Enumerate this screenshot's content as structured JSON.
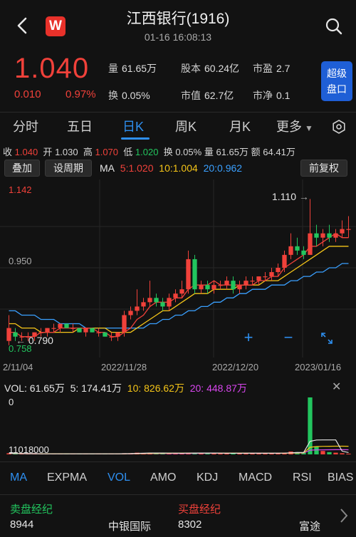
{
  "header": {
    "title": "江西银行(1916)",
    "subtitle": "01-16 16:08:13",
    "logo_letter": "W"
  },
  "quote": {
    "price": "1.040",
    "change": "0.010",
    "change_pct": "0.97%",
    "stats": [
      {
        "k": "量",
        "v": "61.65万"
      },
      {
        "k": "股本",
        "v": "60.24亿"
      },
      {
        "k": "市盈",
        "v": "2.7"
      },
      {
        "k": "换",
        "v": "0.05%"
      },
      {
        "k": "市值",
        "v": "62.7亿"
      },
      {
        "k": "市净",
        "v": "0.1"
      }
    ],
    "super_btn_l1": "超级",
    "super_btn_l2": "盘口"
  },
  "tabs": [
    "分时",
    "五日",
    "日K",
    "周K",
    "月K",
    "更多"
  ],
  "active_tab": "日K",
  "infobar": {
    "close_k": "收",
    "close_v": "1.040",
    "open_k": "开",
    "open_v": "1.030",
    "high_k": "高",
    "high_v": "1.070",
    "low_k": "低",
    "low_v": "1.020",
    "turn_k": "换",
    "turn_v": "0.05%",
    "vol_k": "量",
    "vol_v": "61.65万",
    "amt_k": "额",
    "amt_v": "64.41万"
  },
  "toolbar": {
    "overlay": "叠加",
    "period": "设周期",
    "ma_label": "MA",
    "ma5": "5:1.020",
    "ma10": "10:1.004",
    "ma20": "20:0.962",
    "adjust": "前复权"
  },
  "chart_labels": {
    "top": "1.142",
    "mid": "0.950",
    "bottom": "0.758",
    "max_mark": "1.110",
    "min_mark": "0.790",
    "dates": [
      "2/11/04",
      "2022/11/28",
      "2022/12/20",
      "2023/01/16"
    ]
  },
  "volume": {
    "label": "VOL: 61.65万",
    "v5": "5: 174.41万",
    "v10": "10: 826.62万",
    "v20": "20: 448.87万",
    "top": "0",
    "bottom": "11018000"
  },
  "indicators": [
    "MA",
    "EXPMA",
    "VOL",
    "AMO",
    "KDJ",
    "MACD",
    "RSI",
    "BIAS"
  ],
  "active_indicators": [
    "MA",
    "VOL"
  ],
  "brokers": {
    "sell_title": "卖盘经纪",
    "buy_title": "买盘经纪",
    "sell_code": "8944",
    "sell_name": "中银国际",
    "buy_code": "8302",
    "buy_name": "富途"
  },
  "colors": {
    "up": "#f0413a",
    "down": "#22c55e",
    "accent": "#2e8ff0",
    "ma5": "#f0413a",
    "ma10": "#f5c518",
    "ma20": "#3aa0ff"
  },
  "chart_data": {
    "type": "candlestick",
    "ylim": [
      0.758,
      1.142
    ],
    "max": 1.11,
    "min": 0.79,
    "ohlc": [
      [
        0.78,
        0.84,
        0.77,
        0.81
      ],
      [
        0.8,
        0.81,
        0.78,
        0.79
      ],
      [
        0.79,
        0.8,
        0.78,
        0.79
      ],
      [
        0.79,
        0.8,
        0.78,
        0.79
      ],
      [
        0.79,
        0.8,
        0.78,
        0.8
      ],
      [
        0.8,
        0.81,
        0.79,
        0.8
      ],
      [
        0.8,
        0.81,
        0.79,
        0.81
      ],
      [
        0.81,
        0.82,
        0.8,
        0.81
      ],
      [
        0.81,
        0.82,
        0.8,
        0.82
      ],
      [
        0.82,
        0.82,
        0.81,
        0.81
      ],
      [
        0.81,
        0.82,
        0.8,
        0.81
      ],
      [
        0.81,
        0.81,
        0.8,
        0.8
      ],
      [
        0.8,
        0.81,
        0.79,
        0.81
      ],
      [
        0.81,
        0.81,
        0.8,
        0.8
      ],
      [
        0.8,
        0.81,
        0.79,
        0.8
      ],
      [
        0.8,
        0.8,
        0.79,
        0.79
      ],
      [
        0.79,
        0.8,
        0.78,
        0.79
      ],
      [
        0.79,
        0.8,
        0.78,
        0.8
      ],
      [
        0.8,
        0.85,
        0.79,
        0.84
      ],
      [
        0.84,
        0.86,
        0.83,
        0.85
      ],
      [
        0.85,
        0.9,
        0.84,
        0.86
      ],
      [
        0.86,
        0.88,
        0.85,
        0.87
      ],
      [
        0.87,
        0.92,
        0.86,
        0.88
      ],
      [
        0.88,
        0.89,
        0.86,
        0.87
      ],
      [
        0.87,
        0.88,
        0.85,
        0.86
      ],
      [
        0.86,
        0.89,
        0.85,
        0.88
      ],
      [
        0.88,
        0.9,
        0.87,
        0.89
      ],
      [
        0.89,
        0.92,
        0.88,
        0.9
      ],
      [
        0.9,
        0.99,
        0.89,
        0.97
      ],
      [
        0.97,
        0.98,
        0.89,
        0.9
      ],
      [
        0.9,
        0.92,
        0.89,
        0.91
      ],
      [
        0.91,
        0.92,
        0.89,
        0.9
      ],
      [
        0.9,
        0.92,
        0.89,
        0.91
      ],
      [
        0.91,
        0.92,
        0.9,
        0.91
      ],
      [
        0.91,
        0.93,
        0.9,
        0.92
      ],
      [
        0.92,
        0.93,
        0.89,
        0.9
      ],
      [
        0.9,
        0.92,
        0.89,
        0.91
      ],
      [
        0.91,
        0.93,
        0.9,
        0.92
      ],
      [
        0.92,
        0.93,
        0.91,
        0.92
      ],
      [
        0.92,
        0.93,
        0.91,
        0.93
      ],
      [
        0.93,
        0.94,
        0.92,
        0.93
      ],
      [
        0.93,
        0.95,
        0.92,
        0.94
      ],
      [
        0.94,
        0.96,
        0.93,
        0.95
      ],
      [
        0.95,
        0.99,
        0.94,
        0.98
      ],
      [
        0.98,
        1.03,
        0.97,
        1.0
      ],
      [
        1.0,
        1.02,
        0.98,
        0.99
      ],
      [
        0.99,
        1.0,
        0.97,
        0.98
      ],
      [
        0.98,
        1.11,
        0.98,
        1.03
      ],
      [
        1.03,
        1.05,
        1.0,
        1.02
      ],
      [
        1.02,
        1.04,
        1.0,
        1.03
      ],
      [
        1.03,
        1.05,
        1.01,
        1.02
      ],
      [
        1.02,
        1.04,
        1.01,
        1.03
      ],
      [
        1.03,
        1.06,
        1.02,
        1.04
      ],
      [
        1.04,
        1.07,
        1.02,
        1.04
      ]
    ],
    "ma5": [
      0.8,
      0.8,
      0.79,
      0.79,
      0.79,
      0.8,
      0.8,
      0.8,
      0.81,
      0.81,
      0.81,
      0.81,
      0.81,
      0.81,
      0.8,
      0.8,
      0.79,
      0.79,
      0.8,
      0.81,
      0.83,
      0.84,
      0.86,
      0.87,
      0.87,
      0.87,
      0.88,
      0.88,
      0.9,
      0.91,
      0.91,
      0.91,
      0.92,
      0.91,
      0.91,
      0.91,
      0.91,
      0.91,
      0.91,
      0.92,
      0.92,
      0.93,
      0.93,
      0.95,
      0.96,
      0.97,
      0.98,
      1.0,
      1.0,
      1.01,
      1.02,
      1.03,
      1.02,
      1.02
    ],
    "ma10": [
      0.82,
      0.82,
      0.81,
      0.81,
      0.81,
      0.8,
      0.8,
      0.8,
      0.8,
      0.8,
      0.8,
      0.81,
      0.81,
      0.81,
      0.81,
      0.81,
      0.8,
      0.8,
      0.8,
      0.8,
      0.81,
      0.82,
      0.83,
      0.84,
      0.85,
      0.85,
      0.86,
      0.87,
      0.88,
      0.89,
      0.89,
      0.89,
      0.9,
      0.9,
      0.9,
      0.9,
      0.91,
      0.91,
      0.91,
      0.91,
      0.92,
      0.92,
      0.92,
      0.93,
      0.94,
      0.95,
      0.96,
      0.97,
      0.98,
      0.99,
      1.0,
      1.0,
      1.0,
      1.0
    ],
    "ma20": [
      0.85,
      0.85,
      0.84,
      0.84,
      0.84,
      0.83,
      0.83,
      0.83,
      0.82,
      0.82,
      0.82,
      0.82,
      0.81,
      0.81,
      0.81,
      0.81,
      0.81,
      0.81,
      0.81,
      0.81,
      0.81,
      0.81,
      0.82,
      0.82,
      0.83,
      0.83,
      0.84,
      0.84,
      0.85,
      0.85,
      0.86,
      0.86,
      0.87,
      0.87,
      0.88,
      0.88,
      0.89,
      0.89,
      0.9,
      0.9,
      0.9,
      0.91,
      0.91,
      0.91,
      0.92,
      0.92,
      0.93,
      0.93,
      0.94,
      0.94,
      0.95,
      0.95,
      0.96,
      0.96
    ],
    "volume": [
      2,
      1,
      1,
      1,
      1,
      1,
      1,
      1,
      1,
      1,
      1,
      1,
      1,
      1,
      1,
      1,
      1,
      1,
      2,
      2,
      3,
      2,
      3,
      2,
      2,
      2,
      2,
      2,
      3,
      3,
      2,
      2,
      2,
      2,
      2,
      2,
      2,
      2,
      2,
      2,
      2,
      2,
      2,
      3,
      5,
      4,
      3,
      100,
      14,
      6,
      4,
      3,
      2,
      1
    ]
  }
}
